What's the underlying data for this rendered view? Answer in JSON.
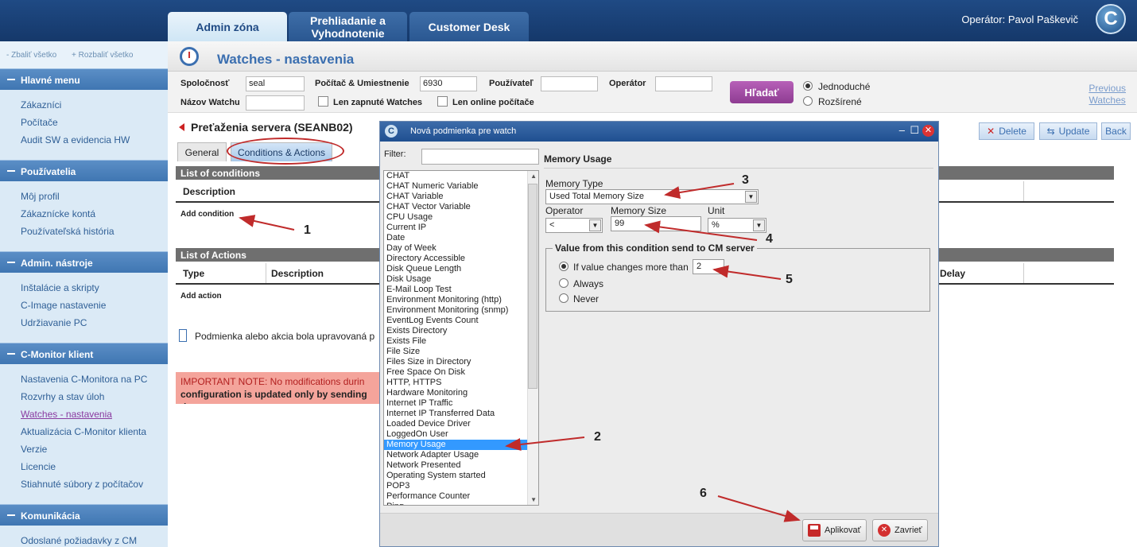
{
  "header": {
    "tabs": [
      {
        "label": "Admin zóna"
      },
      {
        "label": "Prehliadanie a Vyhodnotenie"
      },
      {
        "label": "Customer Desk"
      }
    ],
    "operator": "Operátor: Pavol Paškevič",
    "logo_letter": "C"
  },
  "sidebar": {
    "collapse_all": "- Zbaliť všetko",
    "expand_all": "+ Rozbaliť všetko",
    "sections": [
      {
        "title": "Hlavné menu",
        "items": [
          "Zákazníci",
          "Počítače",
          "Audit SW a evidencia HW"
        ]
      },
      {
        "title": "Používatelia",
        "items": [
          "Môj profil",
          "Zákaznícke kontá",
          "Používateľská história"
        ]
      },
      {
        "title": "Admin. nástroje",
        "items": [
          "Inštalácie a skripty",
          "C-Image nastavenie",
          "Udržiavanie PC"
        ]
      },
      {
        "title": "C-Monitor klient",
        "items": [
          "Nastavenia C-Monitora na PC",
          "Rozvrhy a stav úloh",
          "Watches - nastavenia",
          "Aktualizácia C-Monitor klienta",
          "Verzie",
          "Licencie",
          "Stiahnuté súbory z počítačov"
        ]
      },
      {
        "title": "Komunikácia",
        "items": [
          "Odoslané požiadavky z CM"
        ]
      }
    ],
    "current_item": "Watches - nastavenia"
  },
  "page": {
    "title": "Watches - nastavenia",
    "filters": {
      "company_label": "Spoločnosť",
      "company_value": "seal",
      "computer_label": "Počítač & Umiestnenie",
      "computer_value": "6930",
      "user_label": "Používateľ",
      "operator_label": "Operátor",
      "watch_name_label": "Názov Watchu",
      "only_enabled_label": "Len zapnuté Watches",
      "only_online_label": "Len online počítače",
      "search_button": "Hľadať",
      "simple_label": "Jednoduché",
      "advanced_label": "Rozšírené",
      "previous_line1": "Previous",
      "previous_line2": "Watches"
    },
    "watch_title": "Preťaženia servera (SEANB02)",
    "buttons": {
      "delete": "Delete",
      "update": "Update",
      "back": "Back"
    },
    "tabs": {
      "general": "General",
      "conditions": "Conditions & Actions"
    },
    "conditions_section": "List of conditions",
    "conditions_col_description": "Description",
    "add_condition": "Add condition",
    "actions_section": "List of Actions",
    "actions_col_type": "Type",
    "actions_col_description": "Description",
    "actions_col_delay": "Delay",
    "add_action": "Add action",
    "info_text": "Podmienka alebo akcia bola upravovaná p",
    "note_line1": "IMPORTANT NOTE: No modifications durin",
    "note_line2": "configuration is updated only by sending the"
  },
  "modal": {
    "title": "Nová podmienka pre watch",
    "filter_label": "Filter:",
    "list_items": [
      "CHAT",
      "CHAT Numeric Variable",
      "CHAT Variable",
      "CHAT Vector Variable",
      "CPU Usage",
      "Current IP",
      "Date",
      "Day of Week",
      "Directory Accessible",
      "Disk Queue Length",
      "Disk Usage",
      "E-Mail Loop Test",
      "Environment Monitoring (http)",
      "Environment Monitoring (snmp)",
      "EventLog Events Count",
      "Exists Directory",
      "Exists File",
      "File Size",
      "Files Size in Directory",
      "Free Space On Disk",
      "HTTP, HTTPS",
      "Hardware Monitoring",
      "Internet IP Traffic",
      "Internet IP Transferred Data",
      "Loaded Device Driver",
      "LoggedOn User",
      "Memory Usage",
      "Network Adapter Usage",
      "Network Presented",
      "Operating System started",
      "POP3",
      "Performance Counter",
      "Ping"
    ],
    "selected_item": "Memory Usage",
    "panel_title": "Memory Usage",
    "memory_type_label": "Memory Type",
    "memory_type_value": "Used Total Memory Size",
    "operator_label": "Operator",
    "operator_value": "<",
    "memory_size_label": "Memory Size",
    "memory_size_value": "99",
    "unit_label": "Unit",
    "unit_value": "%",
    "fieldset_legend": "Value from this condition send to CM server",
    "radio_if_changes": "If value changes more than",
    "radio_if_changes_value": "2",
    "radio_always": "Always",
    "radio_never": "Never",
    "apply_button": "Aplikovať",
    "close_button": "Zavrieť"
  },
  "annotations": [
    "1",
    "2",
    "3",
    "4",
    "5",
    "6"
  ],
  "colors": {
    "arrow": "#c02b2b",
    "header_blue": "#1f4a84",
    "selected_blue": "#3399ff"
  }
}
